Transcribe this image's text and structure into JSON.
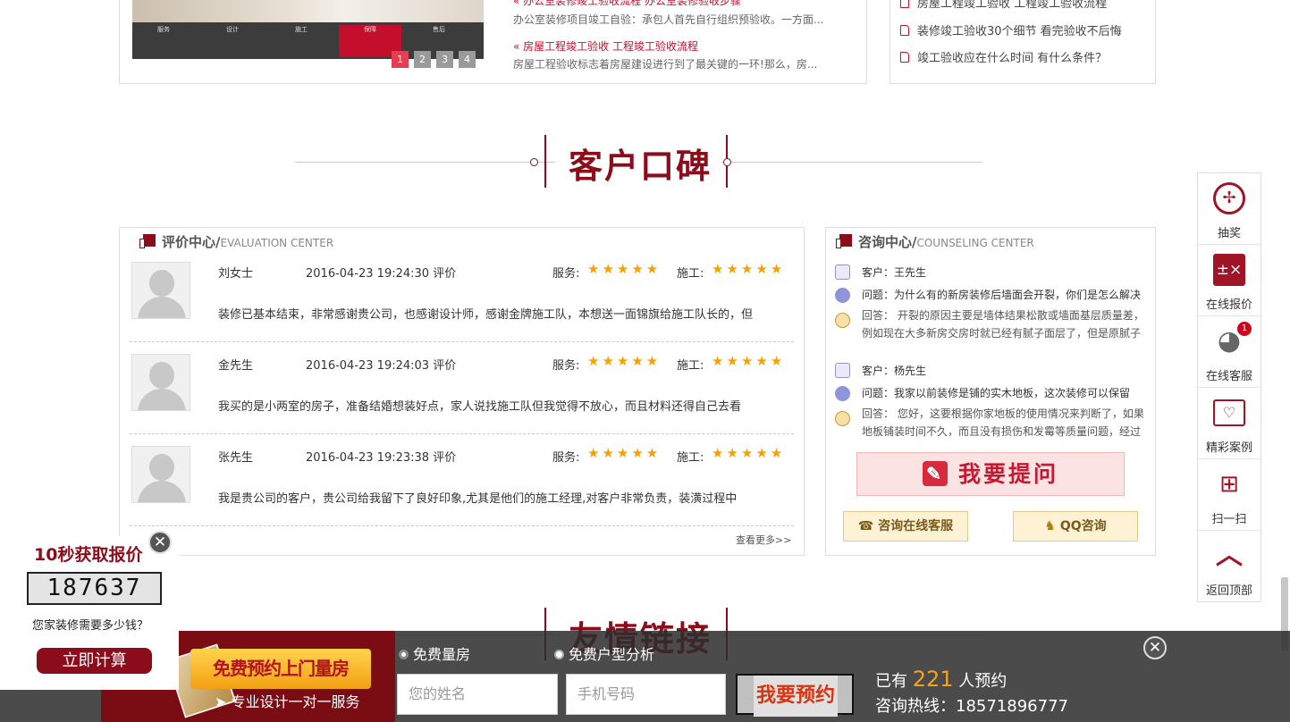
{
  "news": {
    "pager": [
      "1",
      "2",
      "3",
      "4"
    ],
    "items": [
      {
        "title": "办公室装修竣工验收流程 办公室装修验收步骤",
        "desc": "办公室装修项目竣工自验：承包人首先自行组织预验收。一方面..."
      },
      {
        "title": "房屋工程竣工验收 工程竣工验收流程",
        "desc": "房屋工程验收标志着房屋建设进行到了最关键的一环!那么，房..."
      }
    ],
    "right_links": [
      "房屋工程竣工验收 工程竣工验收流程",
      "装修竣工验收30个细节 看完验收不后悔",
      "竣工验收应在什么时间 有什么条件？"
    ]
  },
  "section_title": "客户口碑",
  "section2_title": "友情链接",
  "evaluation": {
    "title": "评价中心/",
    "subtitle": "EVALUATION CENTER",
    "service_label": "服务:",
    "build_label": "施工:",
    "stars": "★★★★★",
    "service_rating": 5,
    "build_rating": 5,
    "more": "查看更多>>",
    "reviews": [
      {
        "name": "刘女士",
        "date": "2016-04-23 19:24:30 评价",
        "text": "装修已基本结束，非常感谢贵公司，也感谢设计师，感谢金牌施工队，本想送一面锦旗给施工队长的，但"
      },
      {
        "name": "金先生",
        "date": "2016-04-23 19:24:03 评价",
        "text": "我买的是小两室的房子，准备结婚想装好点，家人说找施工队但我觉得不放心，而且材料还得自己去看"
      },
      {
        "name": "张先生",
        "date": "2016-04-23 19:23:38 评价",
        "text": "我是贵公司的客户，贵公司给我留下了良好印象,尤其是他们的施工经理,对客户非常负责，装潢过程中"
      }
    ]
  },
  "counseling": {
    "title": "咨询中心/",
    "subtitle": "COUNSELING CENTER",
    "items": [
      {
        "client": "客户：王先生",
        "question": "问题：为什么有的新房装修后墙面会开裂，你们是怎么解决",
        "answer1": "回答： 开裂的原因主要是墙体结果松散或墙面基层质量差，",
        "answer2": "例如现在大多新房交房时就已经有腻子面层了，但是原腻子"
      },
      {
        "client": "客户：杨先生",
        "question": "问题：我家以前装修是铺的实木地板，这次装修可以保留",
        "answer1": "回答： 您好，这要根据你家地板的使用情况来判断了，如果",
        "answer2": "地板铺装时间不久，而且没有损伤和发霉等质量问题，经过"
      }
    ],
    "ask_button": "我要提问",
    "online_button": "咨询在线客服",
    "qq_button": "QQ咨询"
  },
  "sidebar": {
    "items": [
      {
        "label": "抽奖",
        "icon": "lottery-wheel-icon"
      },
      {
        "label": "在线报价",
        "icon": "calculator-icon"
      },
      {
        "label": "在线客服",
        "icon": "headset-icon",
        "badge": "1"
      },
      {
        "label": "精彩案例",
        "icon": "cases-icon"
      },
      {
        "label": "扫一扫",
        "icon": "qrcode-icon"
      },
      {
        "label": "返回顶部",
        "icon": "arrow-up-icon"
      }
    ]
  },
  "calculator": {
    "title": "10秒获取报价",
    "counter": "187637",
    "question": "您家装修需要多少钱？",
    "button": "立即计算"
  },
  "booking": {
    "promo": "免费预约上门量房",
    "promo_sub": "➤ 专业设计一对一服务",
    "option1": "免费量房",
    "option2": "免费户型分析",
    "name_placeholder": "您的姓名",
    "phone_placeholder": "手机号码",
    "button": "我要预约",
    "count_prefix": "已有",
    "count": "221",
    "count_suffix": "人预约",
    "hotline": "咨询热线：18571896777"
  },
  "colors": {
    "brand": "#8b0d1c",
    "star": "#f7a100",
    "accent": "#c40f2c"
  }
}
